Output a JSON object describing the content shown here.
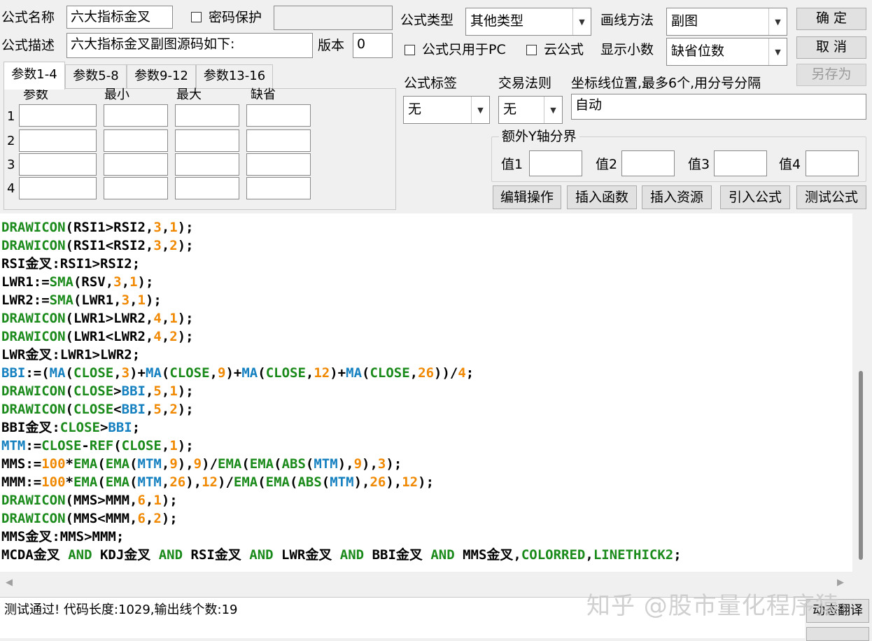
{
  "fields": {
    "name_label": "公式名称",
    "name_value": "六大指标金叉",
    "password_label": "密码保护",
    "desc_label": "公式描述",
    "desc_value": "六大指标金叉副图源码如下:",
    "version_label": "版本",
    "version_value": "0",
    "type_label": "公式类型",
    "type_value": "其他类型",
    "draw_label": "画线方法",
    "draw_value": "副图",
    "pc_only_label": "公式只用于PC",
    "cloud_label": "云公式",
    "decimal_label": "显示小数",
    "decimal_value": "缺省位数",
    "tag_label": "公式标签",
    "tag_value": "无",
    "rule_label": "交易法则",
    "rule_value": "无",
    "axis_label": "坐标线位置,最多6个,用分号分隔",
    "axis_value": "自动",
    "extra_y_label": "额外Y轴分界",
    "val1_label": "值1",
    "val2_label": "值2",
    "val3_label": "值3",
    "val4_label": "值4"
  },
  "buttons": {
    "ok": "确  定",
    "cancel": "取  消",
    "save_as": "另存为",
    "edit_ops": "编辑操作",
    "insert_func": "插入函数",
    "insert_res": "插入资源",
    "import_formula": "引入公式",
    "test_formula": "测试公式",
    "dynamic_translate": "动态翻译"
  },
  "tabs": [
    "参数1-4",
    "参数5-8",
    "参数9-12",
    "参数13-16"
  ],
  "params": {
    "headers": [
      "参数",
      "最小",
      "最大",
      "缺省"
    ],
    "rows": [
      "1",
      "2",
      "3",
      "4"
    ]
  },
  "code_lines": [
    [
      [
        "f",
        "DRAWICON"
      ],
      [
        "p",
        "(RSI1>RSI2,"
      ],
      [
        "n",
        "3"
      ],
      [
        "p",
        ","
      ],
      [
        "n",
        "1"
      ],
      [
        "p",
        ");"
      ]
    ],
    [
      [
        "f",
        "DRAWICON"
      ],
      [
        "p",
        "(RSI1<RSI2,"
      ],
      [
        "n",
        "3"
      ],
      [
        "p",
        ","
      ],
      [
        "n",
        "2"
      ],
      [
        "p",
        ");"
      ]
    ],
    [
      [
        "p",
        "RSI金叉:RSI1>RSI2;"
      ]
    ],
    [
      [
        "p",
        "LWR1:="
      ],
      [
        "f",
        "SMA"
      ],
      [
        "p",
        "(RSV,"
      ],
      [
        "n",
        "3"
      ],
      [
        "p",
        ","
      ],
      [
        "n",
        "1"
      ],
      [
        "p",
        ");"
      ]
    ],
    [
      [
        "p",
        "LWR2:="
      ],
      [
        "f",
        "SMA"
      ],
      [
        "p",
        "(LWR1,"
      ],
      [
        "n",
        "3"
      ],
      [
        "p",
        ","
      ],
      [
        "n",
        "1"
      ],
      [
        "p",
        ");"
      ]
    ],
    [
      [
        "f",
        "DRAWICON"
      ],
      [
        "p",
        "(LWR1>LWR2,"
      ],
      [
        "n",
        "4"
      ],
      [
        "p",
        ","
      ],
      [
        "n",
        "1"
      ],
      [
        "p",
        ");"
      ]
    ],
    [
      [
        "f",
        "DRAWICON"
      ],
      [
        "p",
        "(LWR1<LWR2,"
      ],
      [
        "n",
        "4"
      ],
      [
        "p",
        ","
      ],
      [
        "n",
        "2"
      ],
      [
        "p",
        ");"
      ]
    ],
    [
      [
        "p",
        "LWR金叉:LWR1>LWR2;"
      ]
    ],
    [
      [
        "v",
        "BBI"
      ],
      [
        "p",
        ":=("
      ],
      [
        "v",
        "MA"
      ],
      [
        "p",
        "("
      ],
      [
        "f",
        "CLOSE"
      ],
      [
        "p",
        ","
      ],
      [
        "n",
        "3"
      ],
      [
        "p",
        ")+"
      ],
      [
        "v",
        "MA"
      ],
      [
        "p",
        "("
      ],
      [
        "f",
        "CLOSE"
      ],
      [
        "p",
        ","
      ],
      [
        "n",
        "9"
      ],
      [
        "p",
        ")+"
      ],
      [
        "v",
        "MA"
      ],
      [
        "p",
        "("
      ],
      [
        "f",
        "CLOSE"
      ],
      [
        "p",
        ","
      ],
      [
        "n",
        "12"
      ],
      [
        "p",
        ")+"
      ],
      [
        "v",
        "MA"
      ],
      [
        "p",
        "("
      ],
      [
        "f",
        "CLOSE"
      ],
      [
        "p",
        ","
      ],
      [
        "n",
        "26"
      ],
      [
        "p",
        "))/"
      ],
      [
        "n",
        "4"
      ],
      [
        "p",
        ";"
      ]
    ],
    [
      [
        "f",
        "DRAWICON"
      ],
      [
        "p",
        "("
      ],
      [
        "f",
        "CLOSE"
      ],
      [
        "p",
        ">"
      ],
      [
        "v",
        "BBI"
      ],
      [
        "p",
        ","
      ],
      [
        "n",
        "5"
      ],
      [
        "p",
        ","
      ],
      [
        "n",
        "1"
      ],
      [
        "p",
        ");"
      ]
    ],
    [
      [
        "f",
        "DRAWICON"
      ],
      [
        "p",
        "("
      ],
      [
        "f",
        "CLOSE"
      ],
      [
        "p",
        "<"
      ],
      [
        "v",
        "BBI"
      ],
      [
        "p",
        ","
      ],
      [
        "n",
        "5"
      ],
      [
        "p",
        ","
      ],
      [
        "n",
        "2"
      ],
      [
        "p",
        ");"
      ]
    ],
    [
      [
        "p",
        "BBI金叉:"
      ],
      [
        "f",
        "CLOSE"
      ],
      [
        "p",
        ">"
      ],
      [
        "v",
        "BBI"
      ],
      [
        "p",
        ";"
      ]
    ],
    [
      [
        "v",
        "MTM"
      ],
      [
        "p",
        ":="
      ],
      [
        "f",
        "CLOSE"
      ],
      [
        "p",
        "-"
      ],
      [
        "f",
        "REF"
      ],
      [
        "p",
        "("
      ],
      [
        "f",
        "CLOSE"
      ],
      [
        "p",
        ","
      ],
      [
        "n",
        "1"
      ],
      [
        "p",
        ");"
      ]
    ],
    [
      [
        "p",
        "MMS:="
      ],
      [
        "n",
        "100"
      ],
      [
        "p",
        "*"
      ],
      [
        "f",
        "EMA"
      ],
      [
        "p",
        "("
      ],
      [
        "f",
        "EMA"
      ],
      [
        "p",
        "("
      ],
      [
        "v",
        "MTM"
      ],
      [
        "p",
        ","
      ],
      [
        "n",
        "9"
      ],
      [
        "p",
        "),"
      ],
      [
        "n",
        "9"
      ],
      [
        "p",
        ")/"
      ],
      [
        "f",
        "EMA"
      ],
      [
        "p",
        "("
      ],
      [
        "f",
        "EMA"
      ],
      [
        "p",
        "("
      ],
      [
        "f",
        "ABS"
      ],
      [
        "p",
        "("
      ],
      [
        "v",
        "MTM"
      ],
      [
        "p",
        "),"
      ],
      [
        "n",
        "9"
      ],
      [
        "p",
        "),"
      ],
      [
        "n",
        "3"
      ],
      [
        "p",
        ");"
      ]
    ],
    [
      [
        "p",
        "MMM:="
      ],
      [
        "n",
        "100"
      ],
      [
        "p",
        "*"
      ],
      [
        "f",
        "EMA"
      ],
      [
        "p",
        "("
      ],
      [
        "f",
        "EMA"
      ],
      [
        "p",
        "("
      ],
      [
        "v",
        "MTM"
      ],
      [
        "p",
        ","
      ],
      [
        "n",
        "26"
      ],
      [
        "p",
        "),"
      ],
      [
        "n",
        "12"
      ],
      [
        "p",
        ")/"
      ],
      [
        "f",
        "EMA"
      ],
      [
        "p",
        "("
      ],
      [
        "f",
        "EMA"
      ],
      [
        "p",
        "("
      ],
      [
        "f",
        "ABS"
      ],
      [
        "p",
        "("
      ],
      [
        "v",
        "MTM"
      ],
      [
        "p",
        "),"
      ],
      [
        "n",
        "26"
      ],
      [
        "p",
        "),"
      ],
      [
        "n",
        "12"
      ],
      [
        "p",
        ");"
      ]
    ],
    [
      [
        "f",
        "DRAWICON"
      ],
      [
        "p",
        "(MMS>MMM,"
      ],
      [
        "n",
        "6"
      ],
      [
        "p",
        ","
      ],
      [
        "n",
        "1"
      ],
      [
        "p",
        ");"
      ]
    ],
    [
      [
        "f",
        "DRAWICON"
      ],
      [
        "p",
        "(MMS<MMM,"
      ],
      [
        "n",
        "6"
      ],
      [
        "p",
        ","
      ],
      [
        "n",
        "2"
      ],
      [
        "p",
        ");"
      ]
    ],
    [
      [
        "p",
        "MMS金叉:MMS>MMM;"
      ]
    ],
    [
      [
        "p",
        "MCDA金叉 "
      ],
      [
        "k",
        "AND"
      ],
      [
        "p",
        " KDJ金叉 "
      ],
      [
        "k",
        "AND"
      ],
      [
        "p",
        " RSI金叉 "
      ],
      [
        "k",
        "AND"
      ],
      [
        "p",
        " LWR金叉 "
      ],
      [
        "k",
        "AND"
      ],
      [
        "p",
        " BBI金叉 "
      ],
      [
        "k",
        "AND"
      ],
      [
        "p",
        " MMS金叉,"
      ],
      [
        "f",
        "COLORRED"
      ],
      [
        "p",
        ","
      ],
      [
        "f",
        "LINETHICK2"
      ],
      [
        "p",
        ";"
      ]
    ]
  ],
  "status_text": "测试通过! 代码长度:1029,输出线个数:19",
  "watermark": "知乎 @股市量化程序猿",
  "colors": {
    "function": "#1a8a1a",
    "number": "#f08800",
    "variable": "#1580c0"
  }
}
